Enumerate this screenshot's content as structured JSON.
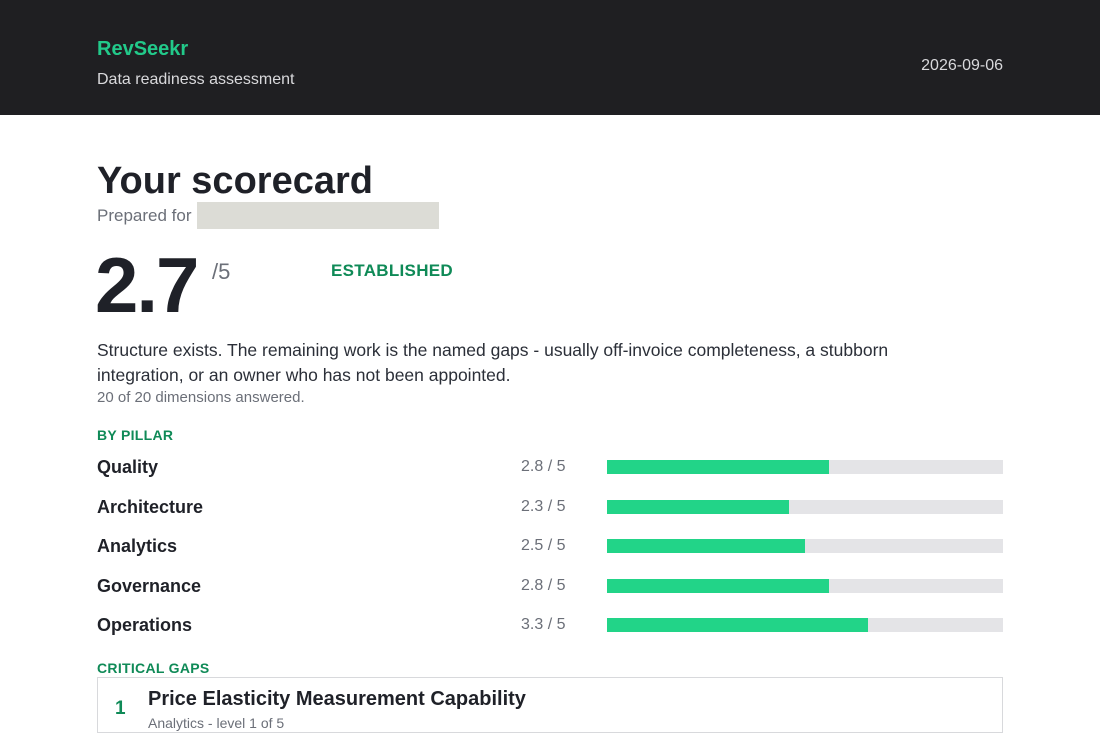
{
  "header": {
    "brand": "RevSeekr",
    "tagline": "Data readiness assessment",
    "date": "2026-09-06"
  },
  "scorecard": {
    "title": "Your scorecard",
    "prepared_for_label": "Prepared for",
    "score": "2.7",
    "score_max": "/5",
    "tier": "ESTABLISHED",
    "summary": "Structure exists. The remaining work is the named gaps - usually off-invoice completeness, a stubborn integration, or an owner who has not been appointed.",
    "answered": "20 of 20 dimensions answered."
  },
  "pillars": {
    "label": "BY PILLAR",
    "items": [
      {
        "name": "Quality",
        "score_text": "2.8 / 5",
        "value": 2.8
      },
      {
        "name": "Architecture",
        "score_text": "2.3 / 5",
        "value": 2.3
      },
      {
        "name": "Analytics",
        "score_text": "2.5 / 5",
        "value": 2.5
      },
      {
        "name": "Governance",
        "score_text": "2.8 / 5",
        "value": 2.8
      },
      {
        "name": "Operations",
        "score_text": "3.3 / 5",
        "value": 3.3
      }
    ],
    "max": 5
  },
  "gaps": {
    "label": "CRITICAL GAPS",
    "items": [
      {
        "rank": "1",
        "title": "Price Elasticity Measurement Capability",
        "meta": "Analytics  -  level 1 of 5"
      }
    ]
  },
  "colors": {
    "accent": "#22c98a",
    "accent_dark": "#0f8a57",
    "bar_fill": "#22d488",
    "bar_track": "#e4e4e7",
    "header_bg": "#1f1f22"
  }
}
